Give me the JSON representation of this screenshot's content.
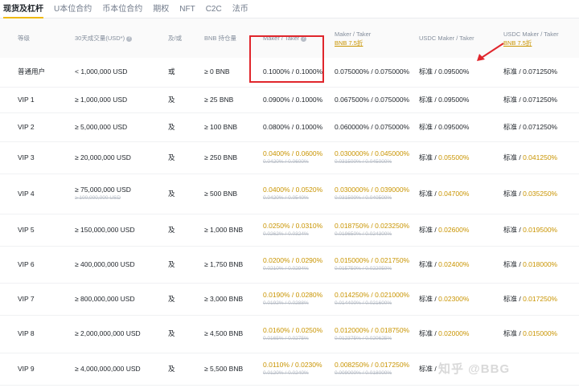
{
  "tabs": [
    "现货及杠杆",
    "U本位合约",
    "币本位合约",
    "期权",
    "NFT",
    "C2C",
    "法币"
  ],
  "table": {
    "headers": {
      "level": "等级",
      "volume": "30天成交量(USD*)",
      "and_or": "及/或",
      "bnb": "BNB 持仓量",
      "mt1": "Maker / Taker",
      "mt2": "Maker / Taker",
      "mt2_link": "BNB 7.5折",
      "usdc1": "USDC Maker / Taker",
      "usdc2": "USDC Maker / Taker",
      "usdc2_link": "BNB 7.5折",
      "info_icon": "info-icon"
    },
    "rows": [
      {
        "level": "普通用户",
        "volume": "< 1,000,000 USD",
        "volume_strike": "",
        "andor": "或",
        "bnb": "≥ 0 BNB",
        "mt": "0.1000% / 0.1000%",
        "mt_strike": "",
        "mtb": "0.075000% / 0.075000%",
        "mtb_strike": "",
        "usdc_prefix": "标准 / ",
        "usdc": "0.09500%",
        "usdcb_prefix": "标准 / ",
        "usdcb": "0.071250%",
        "discount": false
      },
      {
        "level": "VIP 1",
        "volume": "≥ 1,000,000 USD",
        "volume_strike": "",
        "andor": "及",
        "bnb": "≥ 25 BNB",
        "mt": "0.0900% / 0.1000%",
        "mt_strike": "",
        "mtb": "0.067500% / 0.075000%",
        "mtb_strike": "",
        "usdc_prefix": "标准 / ",
        "usdc": "0.09500%",
        "usdcb_prefix": "标准 / ",
        "usdcb": "0.071250%",
        "discount": false
      },
      {
        "level": "VIP 2",
        "volume": "≥ 5,000,000 USD",
        "volume_strike": "",
        "andor": "及",
        "bnb": "≥ 100 BNB",
        "mt": "0.0800% / 0.1000%",
        "mt_strike": "",
        "mtb": "0.060000% / 0.075000%",
        "mtb_strike": "",
        "usdc_prefix": "标准 / ",
        "usdc": "0.09500%",
        "usdcb_prefix": "标准 / ",
        "usdcb": "0.071250%",
        "discount": false
      },
      {
        "level": "VIP 3",
        "volume": "≥ 20,000,000 USD",
        "volume_strike": "",
        "andor": "及",
        "bnb": "≥ 250 BNB",
        "mt": "0.0400% / 0.0600%",
        "mt_strike": "0.0420% / 0.0600%",
        "mtb": "0.030000% / 0.045000%",
        "mtb_strike": "0.031500% / 0.045000%",
        "usdc_prefix": "标准 / ",
        "usdc": "0.05500%",
        "usdcb_prefix": "标准 / ",
        "usdcb": "0.041250%",
        "discount": true
      },
      {
        "level": "VIP 4",
        "volume": "≥ 75,000,000 USD",
        "volume_strike": "≥ 100,000,000 USD",
        "andor": "及",
        "bnb": "≥ 500 BNB",
        "mt": "0.0400% / 0.0520%",
        "mt_strike": "0.0420% / 0.0540%",
        "mtb": "0.030000% / 0.039000%",
        "mtb_strike": "0.031500% / 0.040500%",
        "usdc_prefix": "标准 / ",
        "usdc": "0.04700%",
        "usdcb_prefix": "标准 / ",
        "usdcb": "0.035250%",
        "discount": true
      },
      {
        "level": "VIP 5",
        "volume": "≥ 150,000,000 USD",
        "volume_strike": "",
        "andor": "及",
        "bnb": "≥ 1,000 BNB",
        "mt": "0.0250% / 0.0310%",
        "mt_strike": "0.0262% / 0.0324%",
        "mtb": "0.018750% / 0.023250%",
        "mtb_strike": "0.019650% / 0.024300%",
        "usdc_prefix": "标准 / ",
        "usdc": "0.02600%",
        "usdcb_prefix": "标准 / ",
        "usdcb": "0.019500%",
        "discount": true
      },
      {
        "level": "VIP 6",
        "volume": "≥ 400,000,000 USD",
        "volume_strike": "",
        "andor": "及",
        "bnb": "≥ 1,750 BNB",
        "mt": "0.0200% / 0.0290%",
        "mt_strike": "0.0210% / 0.0294%",
        "mtb": "0.015000% / 0.021750%",
        "mtb_strike": "0.015750% / 0.022050%",
        "usdc_prefix": "标准 / ",
        "usdc": "0.02400%",
        "usdcb_prefix": "标准 / ",
        "usdcb": "0.018000%",
        "discount": true
      },
      {
        "level": "VIP 7",
        "volume": "≥ 800,000,000 USD",
        "volume_strike": "",
        "andor": "及",
        "bnb": "≥ 3,000 BNB",
        "mt": "0.0190% / 0.0280%",
        "mt_strike": "0.0192% / 0.0288%",
        "mtb": "0.014250% / 0.021000%",
        "mtb_strike": "0.014400% / 0.021600%",
        "usdc_prefix": "标准 / ",
        "usdc": "0.02300%",
        "usdcb_prefix": "标准 / ",
        "usdcb": "0.017250%",
        "discount": true
      },
      {
        "level": "VIP 8",
        "volume": "≥ 2,000,000,000 USD",
        "volume_strike": "",
        "andor": "及",
        "bnb": "≥ 4,500 BNB",
        "mt": "0.0160% / 0.0250%",
        "mt_strike": "0.0165% / 0.0275%",
        "mtb": "0.012000% / 0.018750%",
        "mtb_strike": "0.012375% / 0.020625%",
        "usdc_prefix": "标准 / ",
        "usdc": "0.02000%",
        "usdcb_prefix": "标准 / ",
        "usdcb": "0.015000%",
        "discount": true
      },
      {
        "level": "VIP 9",
        "volume": "≥ 4,000,000,000 USD",
        "volume_strike": "",
        "andor": "及",
        "bnb": "≥ 5,500 BNB",
        "mt": "0.0110% / 0.0230%",
        "mt_strike": "0.0120% / 0.0240%",
        "mtb": "0.008250% / 0.017250%",
        "mtb_strike": "0.009000% / 0.018000%",
        "usdc_prefix": "标准 / ",
        "usdc": "",
        "usdcb_prefix": "",
        "usdcb": "",
        "discount": true
      }
    ]
  },
  "annotations": {
    "highlight_color": "#e0262c"
  },
  "watermark": "知乎 @BBG"
}
